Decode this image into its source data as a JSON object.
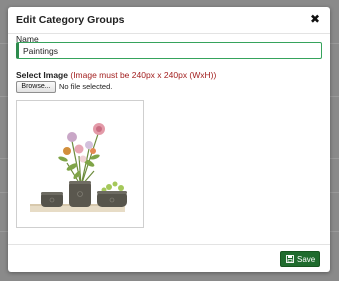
{
  "modal": {
    "title": "Edit Category Groups",
    "close_glyph": "✖"
  },
  "form": {
    "name_label": "Name",
    "name_value": "Paintings",
    "image_label": "Select Image",
    "image_hint": "(Image must be 240px x 240px (WxH))",
    "browse_label": "Browse...",
    "file_status": "No file selected."
  },
  "preview": {
    "icon": "flower-pots-image"
  },
  "footer": {
    "save_label": "Save",
    "save_icon": "floppy-disk-icon"
  },
  "colors": {
    "save_button": "#1f6b2d",
    "input_accent": "#2d8b4d",
    "hint_text": "#a32020"
  }
}
